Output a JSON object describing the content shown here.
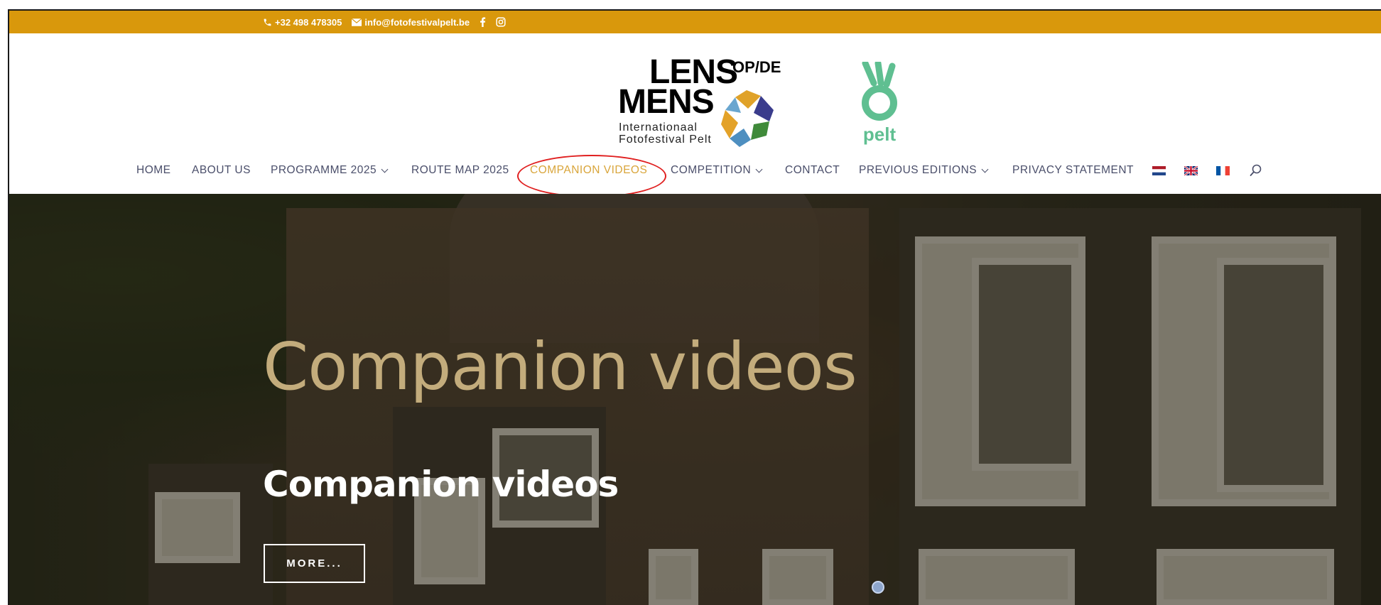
{
  "topbar": {
    "phone": "+32 498 478305",
    "email": "info@fotofestivalpelt.be",
    "icons": [
      "phone-icon",
      "mail-icon",
      "facebook-icon",
      "instagram-icon"
    ],
    "color": "#d9980c"
  },
  "logo": {
    "line1": "LENS",
    "superscript": "OP/DE",
    "line2": "MENS",
    "sub1": "Internationaal",
    "sub2": "Fotofestival Pelt",
    "partner": "pelt"
  },
  "nav": {
    "items": [
      {
        "label": "HOME"
      },
      {
        "label": "ABOUT US"
      },
      {
        "label": "PROGRAMME 2025"
      },
      {
        "label": "ROUTE MAP 2025"
      },
      {
        "label": "COMPANION VIDEOS",
        "active": true
      },
      {
        "label": "COMPETITION"
      },
      {
        "label": "CONTACT"
      },
      {
        "label": "PREVIOUS EDITIONS"
      },
      {
        "label": "PRIVACY STATEMENT"
      }
    ],
    "flags": [
      "nl-flag-icon",
      "uk-flag-icon",
      "fr-flag-icon"
    ],
    "active_color": "#d9a53a",
    "text_color": "#4a4e6a"
  },
  "hero": {
    "title": "Companion videos",
    "subtitle": "Companion videos",
    "button": "MORE...",
    "title_color": "#c3ac7c"
  }
}
